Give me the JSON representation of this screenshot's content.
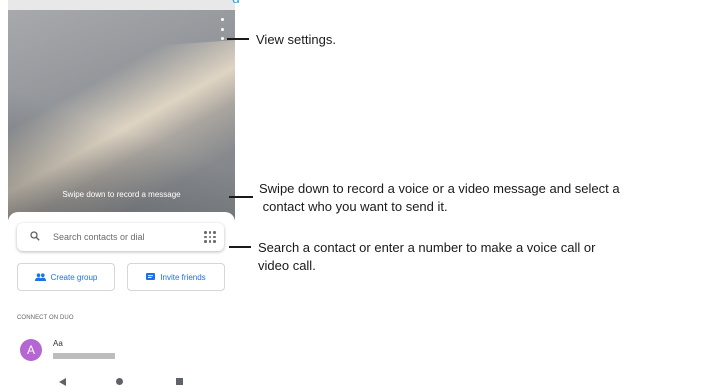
{
  "camera": {
    "swipe_hint": "Swipe down to record a message"
  },
  "search": {
    "placeholder": "Search contacts or dial"
  },
  "actions": {
    "create_group_label": "Create group",
    "invite_friends_label": "Invite friends"
  },
  "connect_section": {
    "label": "CONNECT ON DUO",
    "contacts": [
      {
        "initial": "A",
        "name": "Aa"
      }
    ]
  },
  "callouts": {
    "settings": "View settings.",
    "swipe_line1": "Swipe down to record a voice or a video message and select a",
    "swipe_line2": " contact who you want to send it.",
    "search_line1": "Search a contact or enter a number to make a voice call or",
    "search_line2": "video call."
  },
  "colors": {
    "accent": "#1a73e8",
    "avatar": "#b466d2",
    "title_fragment": "#2aa8df"
  }
}
